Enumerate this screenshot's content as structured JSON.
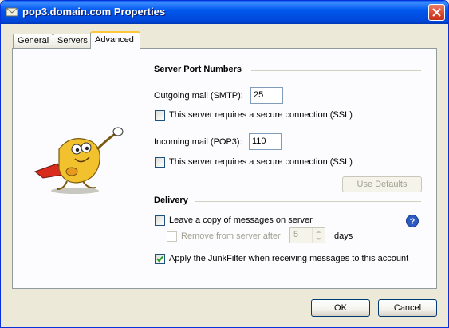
{
  "window": {
    "title": "pop3.domain.com Properties"
  },
  "tabs": [
    {
      "label": "General"
    },
    {
      "label": "Servers"
    },
    {
      "label": "Advanced"
    }
  ],
  "server_ports": {
    "heading": "Server Port Numbers",
    "outgoing_label": "Outgoing mail (SMTP):",
    "outgoing_value": "25",
    "outgoing_ssl_label": "This server requires a secure connection (SSL)",
    "incoming_label": "Incoming mail (POP3):",
    "incoming_value": "110",
    "incoming_ssl_label": "This server requires a secure connection (SSL)",
    "use_defaults_label": "Use Defaults"
  },
  "delivery": {
    "heading": "Delivery",
    "leave_copy_label": "Leave a copy of messages on server",
    "remove_after_label": "Remove from server after",
    "remove_after_days_value": "5",
    "days_label": "days",
    "junkfilter_label": "Apply the JunkFilter when receiving messages to this account",
    "junkfilter_checked": true
  },
  "buttons": {
    "ok": "OK",
    "cancel": "Cancel"
  },
  "colors": {
    "titlebar": "#0058EE",
    "close": "#D9452B",
    "tab_highlight": "#FFC83C",
    "mascot": "#F2C12E"
  }
}
